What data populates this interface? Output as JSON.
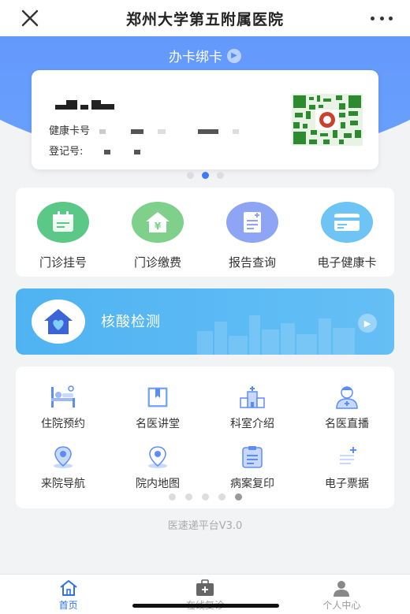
{
  "header": {
    "title": "郑州大学第五附属医院",
    "close_icon": "close-icon",
    "more_icon": "more-icon"
  },
  "hero": {
    "bind_card_label": "办卡绑卡"
  },
  "card": {
    "health_card_label": "健康卡号",
    "reg_label": "登记号:",
    "qr_icon": "qr-code-icon"
  },
  "quick_actions": [
    {
      "label": "门诊挂号",
      "icon": "calendar-icon",
      "color": "#5cc887"
    },
    {
      "label": "门诊缴费",
      "icon": "payment-house-icon",
      "color": "#7fd08a"
    },
    {
      "label": "报告查询",
      "icon": "report-icon",
      "color": "#8ea4f4"
    },
    {
      "label": "电子健康卡",
      "icon": "health-card-icon",
      "color": "#6ec4f4"
    }
  ],
  "banner": {
    "label": "核酸检测",
    "icon": "heart-house-icon"
  },
  "grid_items": [
    {
      "label": "住院预约",
      "icon": "hospital-bed-icon"
    },
    {
      "label": "名医讲堂",
      "icon": "bookmark-book-icon"
    },
    {
      "label": "科室介绍",
      "icon": "hospital-building-icon"
    },
    {
      "label": "名医直播",
      "icon": "doctor-icon"
    },
    {
      "label": "来院导航",
      "icon": "location-pin-icon"
    },
    {
      "label": "院内地图",
      "icon": "map-pin-icon"
    },
    {
      "label": "病案复印",
      "icon": "document-icon"
    },
    {
      "label": "电子票据",
      "icon": "receipt-icon"
    }
  ],
  "version": "医速递平台V3.0",
  "bottom_nav": [
    {
      "label": "首页",
      "icon": "home-icon",
      "active": true
    },
    {
      "label": "在线复诊",
      "icon": "medical-kit-icon",
      "active": false
    },
    {
      "label": "个人中心",
      "icon": "person-icon",
      "active": false
    }
  ],
  "colors": {
    "primary": "#5a8dfb",
    "banner": "#4fb3f2",
    "active_nav": "#2f6fe8"
  }
}
